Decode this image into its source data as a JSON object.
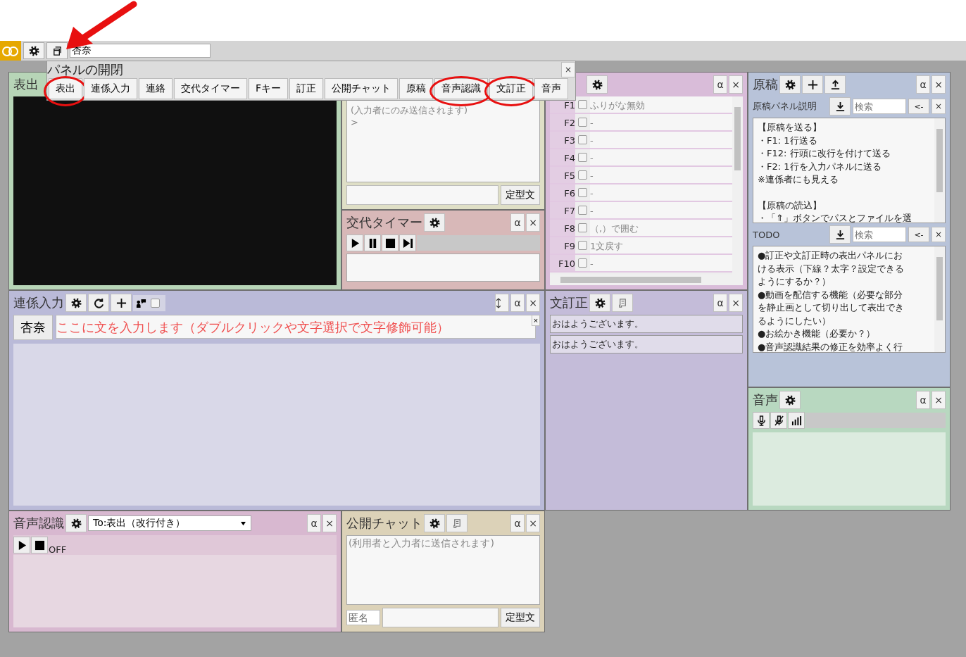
{
  "toolbar": {
    "user_name": "杏奈"
  },
  "panel_toggle": {
    "title": "パネルの開閉",
    "close": "×",
    "items": [
      {
        "label": "表出",
        "circled": true
      },
      {
        "label": "連係入力",
        "circled": false
      },
      {
        "label": "連絡",
        "circled": false
      },
      {
        "label": "交代タイマー",
        "circled": false
      },
      {
        "label": "Fキー",
        "circled": false
      },
      {
        "label": "訂正",
        "circled": false
      },
      {
        "label": "公開チャット",
        "circled": false
      },
      {
        "label": "原稿",
        "circled": false
      },
      {
        "label": "音声認識",
        "circled": true
      },
      {
        "label": "文訂正",
        "circled": true
      },
      {
        "label": "音声",
        "circled": false
      }
    ]
  },
  "annotation": {
    "arrow": true
  },
  "display_panel": {
    "title": "表出"
  },
  "contact_panel": {
    "log": [
      "(入力者にのみ送信されます)",
      ">"
    ],
    "template_button": "定型文"
  },
  "timer_panel": {
    "title": "交代タイマー",
    "alpha": "α",
    "close": "×"
  },
  "fkey_panel": {
    "alpha": "α",
    "close": "×",
    "rows": [
      {
        "key": "F1",
        "checked": false,
        "text": "ふりがな無効"
      },
      {
        "key": "F2",
        "checked": false,
        "text": "-"
      },
      {
        "key": "F3",
        "checked": false,
        "text": "-"
      },
      {
        "key": "F4",
        "checked": false,
        "text": "-"
      },
      {
        "key": "F5",
        "checked": false,
        "text": "-"
      },
      {
        "key": "F6",
        "checked": false,
        "text": "-"
      },
      {
        "key": "F7",
        "checked": false,
        "text": "-"
      },
      {
        "key": "F8",
        "checked": false,
        "text": "（,）で囲む"
      },
      {
        "key": "F9",
        "checked": false,
        "text": "1文戻す"
      },
      {
        "key": "F10",
        "checked": false,
        "text": "-"
      }
    ]
  },
  "manuscript_panel": {
    "title": "原稿",
    "alpha": "α",
    "close": "×",
    "sections": [
      {
        "title": "原稿パネル説明",
        "search_placeholder": "検索",
        "back_button": "<-",
        "close": "×",
        "paragraphs": [
          [
            "【原稿を送る】",
            "・F1: 1行送る",
            "・F12: 行頭に改行を付けて送る",
            "・F2: 1行を入力パネルに送る",
            "※連係者にも見える"
          ],
          [
            "【原稿の読込】",
            "・「⇑」ボタンでパスとファイルを選"
          ]
        ]
      },
      {
        "title": "TODO",
        "search_placeholder": "検索",
        "back_button": "<-",
        "close": "×",
        "paragraphs": [
          [
            "●訂正や文訂正時の表出パネルにお",
            "ける表示（下線？太字？設定できる",
            "ようにするか？）",
            "●動画を配信する機能（必要な部分",
            "を静止画として切り出して表出でき",
            "るようにしたい）",
            "●お絵かき機能（必要か？）",
            "●音声認識結果の修正を効率よく行"
          ]
        ]
      }
    ]
  },
  "linked_input_panel": {
    "title": "連係入力",
    "alpha": "α",
    "close": "×",
    "broadcast_checked": false,
    "name_button": "杏奈",
    "placeholder": "ここに文を入力します（ダブルクリックや文字選択で文字修飾可能）",
    "clear": "×"
  },
  "sentence_correction_panel": {
    "title": "文訂正",
    "alpha": "α",
    "close": "×",
    "lines": [
      "おはようございます。",
      "おはようございます。"
    ]
  },
  "voice_panel": {
    "title": "音声",
    "alpha": "α",
    "close": "×"
  },
  "speech_recognition_panel": {
    "title": "音声認識",
    "alpha": "α",
    "close": "×",
    "target": "To:表出（改行付き）",
    "status": "OFF"
  },
  "public_chat_panel": {
    "title": "公開チャット",
    "alpha": "α",
    "close": "×",
    "placeholder": "(利用者と入力者に送信されます)",
    "anonymous_placeholder": "匿名",
    "template_button": "定型文"
  }
}
